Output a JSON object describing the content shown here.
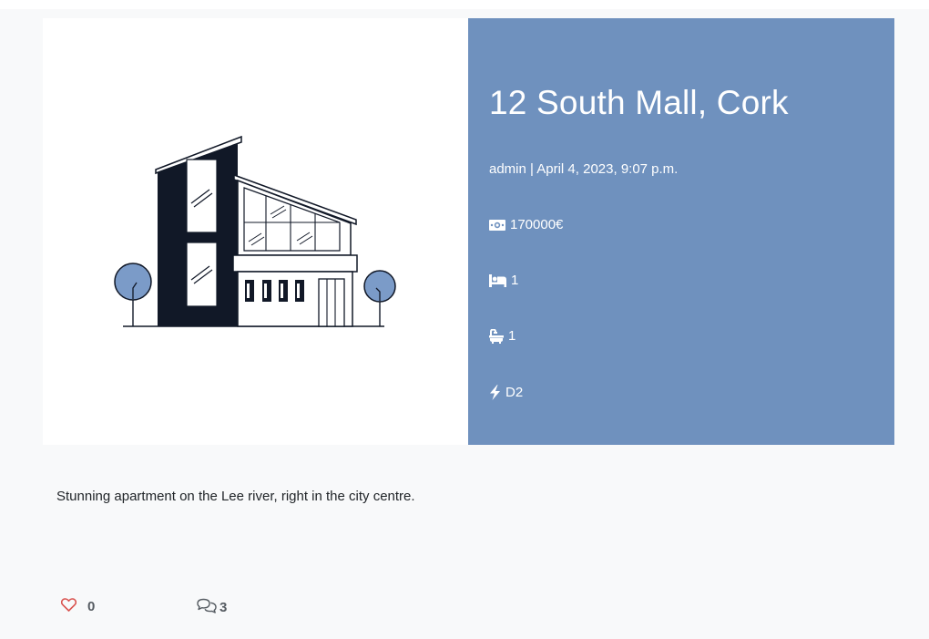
{
  "listing": {
    "title": "12 South Mall, Cork",
    "meta": "admin | April 4, 2023, 9:07 p.m.",
    "price": "170000€",
    "bedrooms": "1",
    "bathrooms": "1",
    "energy_rating": "D2",
    "description": "Stunning apartment on the Lee river, right in the city centre."
  },
  "icons": {
    "price": "money-bill-icon",
    "bedrooms": "bed-icon",
    "bathrooms": "bath-icon",
    "energy": "bolt-icon",
    "like": "heart-icon",
    "comments": "comments-icon"
  },
  "engagement": {
    "likes": "0",
    "comments": "3"
  },
  "colors": {
    "info_panel": "#6f91be",
    "dark_building": "#111827",
    "tree": "#7b9bc8",
    "heart": "#d9534f",
    "page_bg": "#f8f9fa"
  }
}
